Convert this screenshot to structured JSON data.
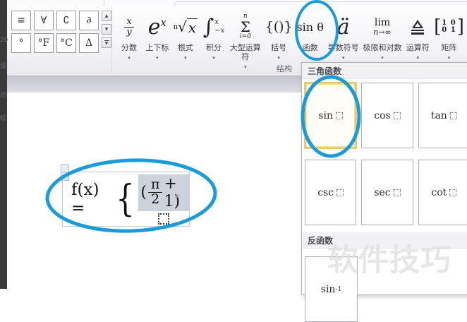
{
  "colors": {
    "annotation_blue": "#1b9cd8",
    "selection_gray": "#ccd3dd",
    "highlight_amber": "#d9a93c"
  },
  "left_strip": {
    "marks": [
      "20",
      "设",
      "功",
      "标"
    ]
  },
  "symbols_gallery": {
    "rows": [
      [
        "≡",
        "∀",
        "∁",
        "∂"
      ],
      [
        "°",
        "°F",
        "°C",
        "Δ"
      ]
    ],
    "scroll": {
      "up": "▲",
      "down": "▼",
      "more": "▼"
    }
  },
  "ribbon": {
    "group_label": "结构",
    "arrow": "▾",
    "buttons": [
      {
        "label": "分数",
        "num": "x",
        "den": "y"
      },
      {
        "label": "上下标",
        "base": "e",
        "sup": "x"
      },
      {
        "label": "根式",
        "index": "n",
        "radical": "√",
        "radicand": "x"
      },
      {
        "label": "积分",
        "sign": "∫",
        "upper": "x",
        "lower": "−x"
      },
      {
        "label": "大型运算符",
        "top": "n",
        "sigma": "Σ",
        "bottom": "i=0"
      },
      {
        "label": "括号",
        "glyph": "{()}"
      },
      {
        "label": "函数",
        "glyph": "sin θ"
      },
      {
        "label": "导数符号",
        "glyph": "ä"
      },
      {
        "label": "极限和对数",
        "top": "lim",
        "bottom": "n→∞"
      },
      {
        "label": "运算符"
      },
      {
        "label": "矩阵",
        "open": "[",
        "row1": "1 0",
        "row2": "0 1",
        "close": "]"
      }
    ]
  },
  "dropdown": {
    "section1_title": "三角函数",
    "section2_title": "反函数",
    "row1": [
      "sin",
      "cos",
      "tan"
    ],
    "row2": [
      "csc",
      "sec",
      "cot"
    ],
    "row3_base": "sin",
    "row3_sup": "-1",
    "selected_cell": "sin"
  },
  "equation": {
    "lhs": "f(x) =",
    "brace": "{",
    "open_paren": "(",
    "numerator": "π",
    "denominator": "2",
    "tail": "+ 1)"
  },
  "watermark": "软件技巧"
}
